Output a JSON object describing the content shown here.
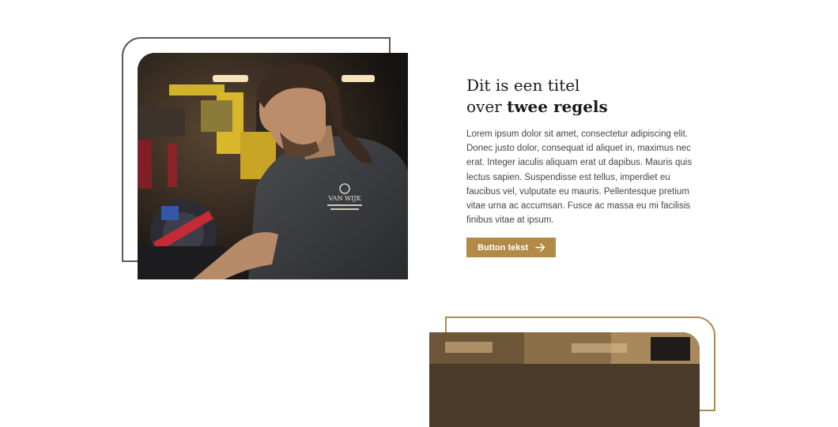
{
  "section_one": {
    "title_line1": "Dit is een titel",
    "title_line2_prefix": "over ",
    "title_line2_bold": "twee regels",
    "body": "Lorem ipsum dolor sit amet, consectetur adipiscing elit. Donec justo dolor, consequat id aliquet in, maximus nec erat. Integer iaculis aliquam erat ut dapibus. Mauris quis lectus sapien. Suspendisse est tellus, imperdiet eu faucibus vel, vulputate eu mauris. Pellentesque pretium vitae urna ac accumsan. Fusce ac massa eu mi facilisis finibus vitae at ipsum.",
    "button_label": "Button tekst",
    "button_icon": "arrow-right-icon",
    "shirt_print": "VAN WIJK"
  },
  "colors": {
    "accent": "#b18a45",
    "frame_dark": "#595959",
    "title_text": "#1a1a1a",
    "body_text": "#444444"
  }
}
